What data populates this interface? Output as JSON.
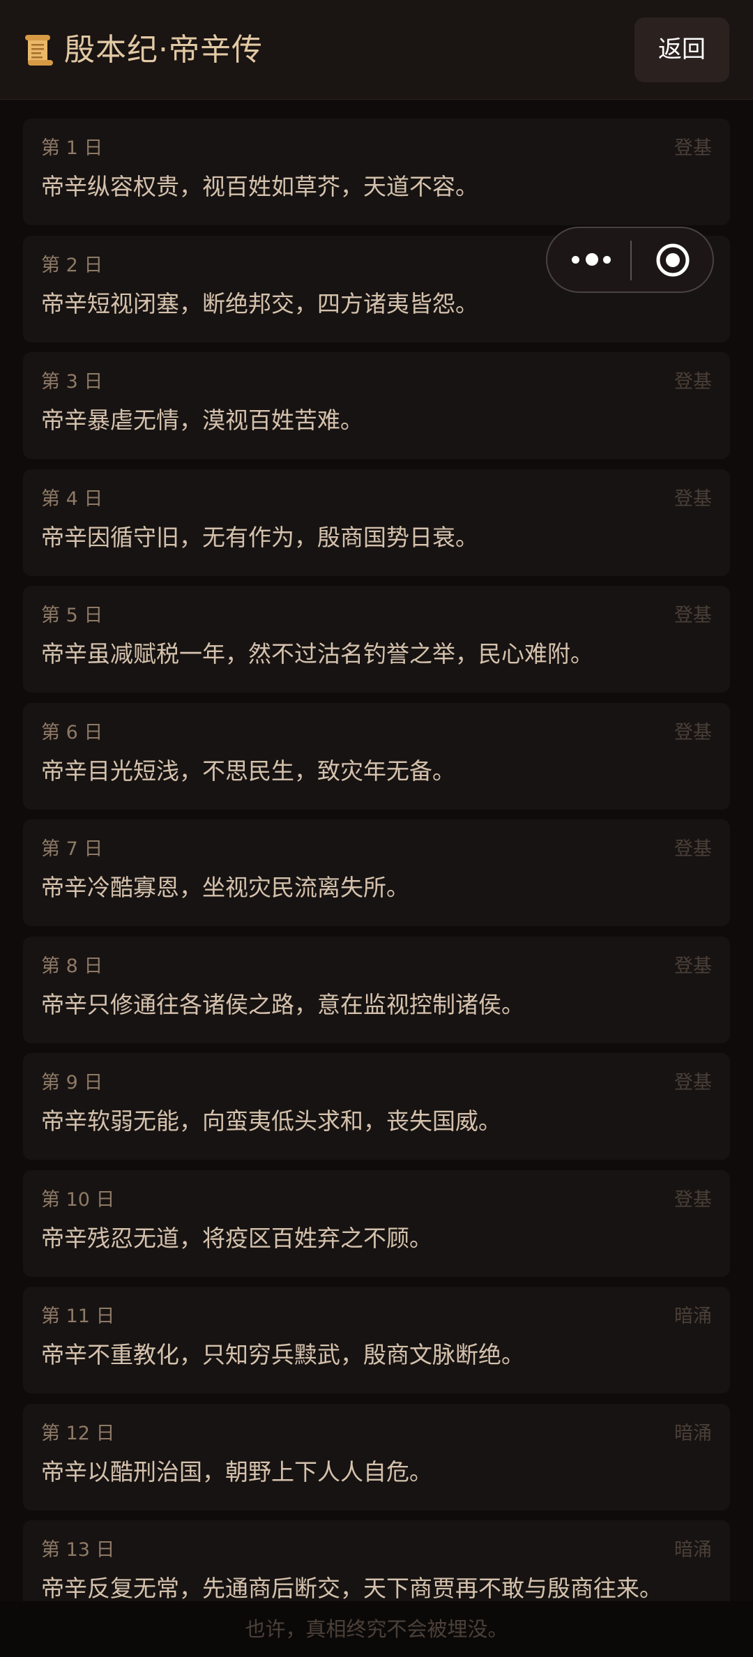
{
  "header": {
    "title": "殷本纪·帝辛传",
    "back_label": "返回",
    "scroll_icon": "scroll-icon"
  },
  "capsule": {
    "more_icon": "more-dots-icon",
    "close_icon": "target-close-icon"
  },
  "entries": [
    {
      "day": "第 1 日",
      "tag": "登基",
      "text": "帝辛纵容权贵，视百姓如草芥，天道不容。"
    },
    {
      "day": "第 2 日",
      "tag": "登基",
      "text": "帝辛短视闭塞，断绝邦交，四方诸夷皆怨。"
    },
    {
      "day": "第 3 日",
      "tag": "登基",
      "text": "帝辛暴虐无情，漠视百姓苦难。"
    },
    {
      "day": "第 4 日",
      "tag": "登基",
      "text": "帝辛因循守旧，无有作为，殷商国势日衰。"
    },
    {
      "day": "第 5 日",
      "tag": "登基",
      "text": "帝辛虽减赋税一年，然不过沽名钓誉之举，民心难附。"
    },
    {
      "day": "第 6 日",
      "tag": "登基",
      "text": "帝辛目光短浅，不思民生，致灾年无备。"
    },
    {
      "day": "第 7 日",
      "tag": "登基",
      "text": "帝辛冷酷寡恩，坐视灾民流离失所。"
    },
    {
      "day": "第 8 日",
      "tag": "登基",
      "text": "帝辛只修通往各诸侯之路，意在监视控制诸侯。"
    },
    {
      "day": "第 9 日",
      "tag": "登基",
      "text": "帝辛软弱无能，向蛮夷低头求和，丧失国威。"
    },
    {
      "day": "第 10 日",
      "tag": "登基",
      "text": "帝辛残忍无道，将疫区百姓弃之不顾。"
    },
    {
      "day": "第 11 日",
      "tag": "暗涌",
      "text": "帝辛不重教化，只知穷兵黩武，殷商文脉断绝。"
    },
    {
      "day": "第 12 日",
      "tag": "暗涌",
      "text": "帝辛以酷刑治国，朝野上下人人自危。"
    },
    {
      "day": "第 13 日",
      "tag": "暗涌",
      "text": "帝辛反复无常，先通商后断交，天下商贾再不敢与殷商往来。"
    }
  ],
  "footer": {
    "text": "也许，真相终究不会被埋没。"
  },
  "colors": {
    "background": "#0e0b0a",
    "header_bg": "#1a1412",
    "title": "#e2c9a4",
    "card_bg": "#171312",
    "day": "#8f7a66",
    "tag": "#4a3f38",
    "text": "#d5c2ad"
  }
}
